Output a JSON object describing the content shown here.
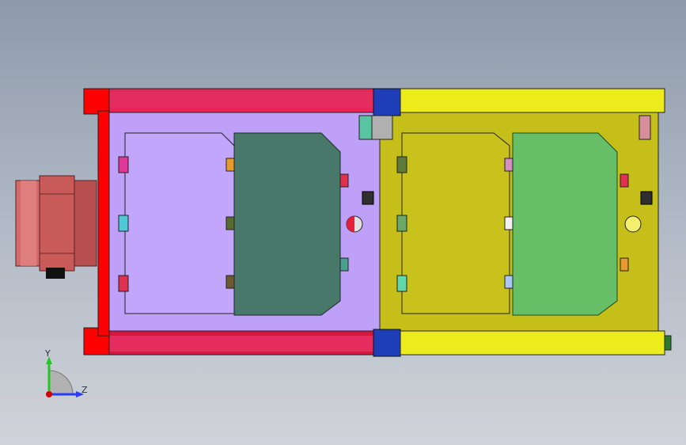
{
  "viewport": {
    "title": "",
    "background": "#a4adba"
  },
  "model": {
    "colors": {
      "red_frame": "#e8245a",
      "red_dark": "#d6173e",
      "yellow_frame": "#ecec1c",
      "purple_panel": "#bea0f8",
      "olive_panel": "#c6bf1a",
      "dark_green_board": "#48786a",
      "light_green_board": "#66be66",
      "blue_block": "#1f3fb8",
      "connector_copper": "#d97474"
    }
  },
  "triad": {
    "y_label": "Y",
    "z_label": "Z",
    "y_color": "#27c427",
    "z_color": "#2a3bff",
    "origin_color": "#d40000"
  }
}
